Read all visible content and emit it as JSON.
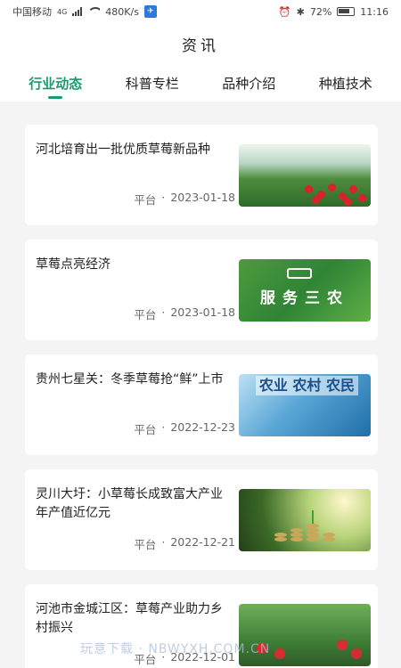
{
  "status_bar": {
    "carrier": "中国移动",
    "network": "4G",
    "speed": "480K/s",
    "battery": "72%",
    "time": "11:16"
  },
  "header": {
    "title": "资讯"
  },
  "tabs": [
    {
      "label": "行业动态",
      "active": true
    },
    {
      "label": "科普专栏",
      "active": false
    },
    {
      "label": "品种介绍",
      "active": false
    },
    {
      "label": "种植技术",
      "active": false
    }
  ],
  "articles": [
    {
      "title": "河北培育出一批优质草莓新品种",
      "source": "平台",
      "date": "2023-01-18",
      "thumb_caption": ""
    },
    {
      "title": "草莓点亮经济",
      "source": "平台",
      "date": "2023-01-18",
      "thumb_caption": "服务三农"
    },
    {
      "title": "贵州七星关：冬季草莓抢“鲜”上市",
      "source": "平台",
      "date": "2022-12-23",
      "thumb_caption": "农业 农村 农民"
    },
    {
      "title": "灵川大圩：小草莓长成致富大产业 年产值近亿元",
      "source": "平台",
      "date": "2022-12-21",
      "thumb_caption": ""
    },
    {
      "title": "河池市金城江区：草莓产业助力乡村振兴",
      "source": "平台",
      "date": "2022-12-01",
      "thumb_caption": ""
    }
  ],
  "separator": "·",
  "watermark": "玩意下载 · NBWYXH.COM.CN",
  "colors": {
    "accent": "#1a9a6d",
    "background": "#f4f4f4"
  }
}
